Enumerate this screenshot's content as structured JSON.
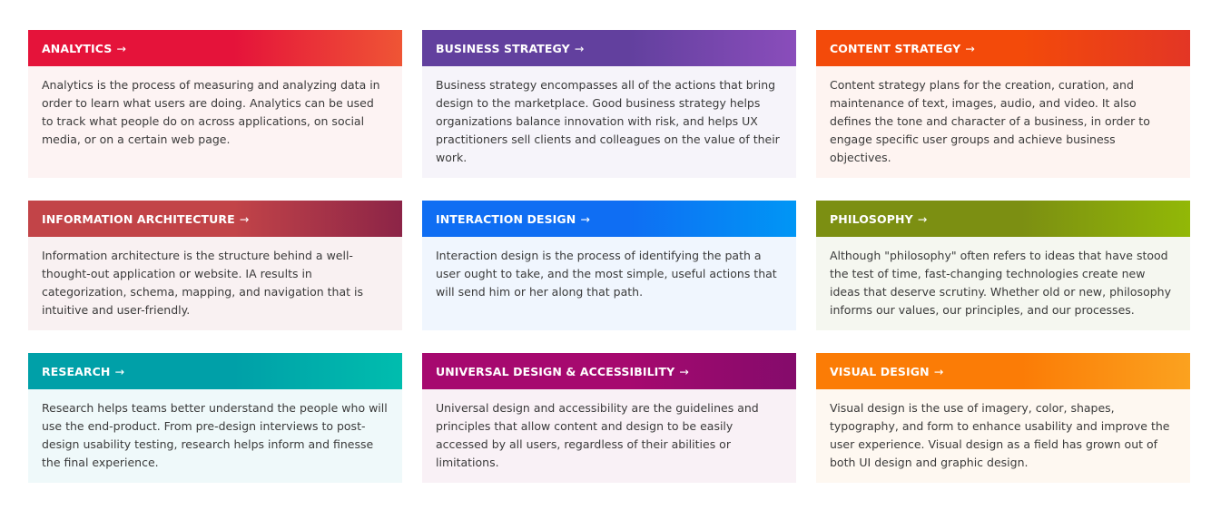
{
  "cards": [
    {
      "title": "ANALYTICS",
      "arrow": "→",
      "description": "Analytics is the process of measuring and analyzing data in order to learn what users are doing. Analytics can be used to track what people do on across applications, on social media, or on a certain web page.",
      "color_start": "#e5133a",
      "color_end": "#ef5535",
      "body_bg": "#fdf3f3"
    },
    {
      "title": "BUSINESS STRATEGY",
      "arrow": "→",
      "description": "Business strategy encompasses all of the actions that bring design to the marketplace. Good business strategy helps organizations balance innovation with risk, and helps UX practitioners sell clients and colleagues on the value of their work.",
      "color_start": "#62409e",
      "color_end": "#8a4dbb",
      "body_bg": "#f6f4fa"
    },
    {
      "title": "CONTENT STRATEGY",
      "arrow": "→",
      "description": "Content strategy plans for the creation, curation, and maintenance of text, images, audio, and video. It also defines the tone and character of a business, in order to engage specific user groups and achieve business objectives.",
      "color_start": "#f34a0a",
      "color_end": "#e33625",
      "body_bg": "#fef4f1"
    },
    {
      "title": "INFORMATION ARCHITECTURE",
      "arrow": "→",
      "description": "Information architecture is the structure behind a well-thought-out application or website. IA results in categorization, schema, mapping, and navigation that is intuitive and user-friendly.",
      "color_start": "#c24448",
      "color_end": "#8c2447",
      "body_bg": "#f9f1f2"
    },
    {
      "title": "INTERACTION DESIGN",
      "arrow": "→",
      "description": "Interaction design is the process of identifying the path a user ought to take, and the most simple, useful actions that will send him or her along that path.",
      "color_start": "#0f6ef3",
      "color_end": "#0096f5",
      "body_bg": "#f0f6fe"
    },
    {
      "title": "PHILOSOPHY",
      "arrow": "→",
      "description": "Although \"philosophy\" often refers to ideas that have stood the test of time, fast-changing technologies create new ideas that deserve scrutiny. Whether old or new, philosophy informs our values, our principles, and our processes.",
      "color_start": "#7c8f12",
      "color_end": "#92b807",
      "body_bg": "#f5f7f0"
    },
    {
      "title": "RESEARCH",
      "arrow": "→",
      "description": "Research helps teams better understand the people who will use the end-product. From pre-design interviews to post-design usability testing, research helps inform and finesse the final experience.",
      "color_start": "#00a0a8",
      "color_end": "#00bdae",
      "body_bg": "#eff9fa"
    },
    {
      "title": "UNIVERSAL DESIGN & ACCESSIBILITY",
      "arrow": "→",
      "description": "Universal design and accessibility are the guidelines and principles that allow content and design to be easily accessed by all users, regardless of their abilities or limitations.",
      "color_start": "#a6096f",
      "color_end": "#840b6b",
      "body_bg": "#f9f1f6"
    },
    {
      "title": "VISUAL DESIGN",
      "arrow": "→",
      "description": "Visual design is the use of imagery, color, shapes, typography, and form to enhance usability and improve the user experience. Visual design as a field has grown out of both UI design and graphic design.",
      "color_start": "#fb7c06",
      "color_end": "#fba21f",
      "body_bg": "#fef8f1"
    }
  ]
}
